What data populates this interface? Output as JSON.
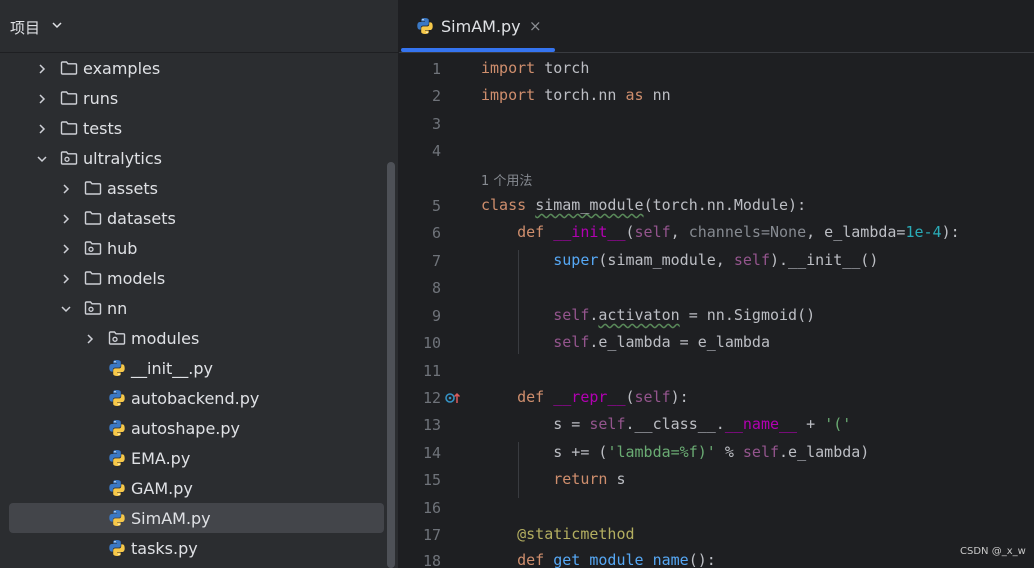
{
  "sidebar": {
    "title": "项目",
    "items": [
      {
        "label": "examples",
        "type": "folder",
        "expanded": false,
        "level": 1
      },
      {
        "label": "runs",
        "type": "folder",
        "expanded": false,
        "level": 1
      },
      {
        "label": "tests",
        "type": "folder",
        "expanded": false,
        "level": 1
      },
      {
        "label": "ultralytics",
        "type": "package",
        "expanded": true,
        "level": 1
      },
      {
        "label": "assets",
        "type": "folder",
        "expanded": false,
        "level": 2
      },
      {
        "label": "datasets",
        "type": "folder",
        "expanded": false,
        "level": 2
      },
      {
        "label": "hub",
        "type": "package",
        "expanded": false,
        "level": 2
      },
      {
        "label": "models",
        "type": "folder",
        "expanded": false,
        "level": 2
      },
      {
        "label": "nn",
        "type": "package",
        "expanded": true,
        "level": 2
      },
      {
        "label": "modules",
        "type": "package",
        "expanded": false,
        "level": 3
      },
      {
        "label": "__init__.py",
        "type": "python",
        "level": 3
      },
      {
        "label": "autobackend.py",
        "type": "python",
        "level": 3
      },
      {
        "label": "autoshape.py",
        "type": "python",
        "level": 3
      },
      {
        "label": "EMA.py",
        "type": "python",
        "level": 3
      },
      {
        "label": "GAM.py",
        "type": "python",
        "level": 3
      },
      {
        "label": "SimAM.py",
        "type": "python",
        "level": 3,
        "selected": true
      },
      {
        "label": "tasks.py",
        "type": "python",
        "level": 3
      }
    ]
  },
  "editor": {
    "tab": {
      "label": "SimAM.py",
      "close": "×"
    },
    "usage_hint": "1 个用法",
    "line_numbers": [
      "1",
      "2",
      "3",
      "4",
      "5",
      "6",
      "7",
      "8",
      "9",
      "10",
      "11",
      "12",
      "13",
      "14",
      "15",
      "16",
      "17",
      "18"
    ],
    "lines": {
      "l1_kw": "import",
      "l1_rest": " torch",
      "l2_kw": "import",
      "l2_mid": " torch.nn ",
      "l2_as": "as",
      "l2_rest": " nn",
      "l5_kw": "class",
      "l5_name": "simam_module",
      "l5_rest": "(torch.nn.Module):",
      "l6_kw": "def",
      "l6_name": "__init__",
      "l6_p1": "(",
      "l6_self": "self",
      "l6_p2": ", ",
      "l6_param": "channels=None",
      "l6_p3": ", e_lambda=",
      "l6_num": "1e-4",
      "l6_p4": "):",
      "l7_super": "super",
      "l7_p1": "(simam_module, ",
      "l7_self": "self",
      "l7_p2": ").__init__()",
      "l9_self": "self",
      "l9_dot": ".",
      "l9_attr": "activaton",
      "l9_rest": " = nn.Sigmoid()",
      "l10_self": "self",
      "l10_rest": ".e_lambda = e_lambda",
      "l12_kw": "def",
      "l12_name": "__repr__",
      "l12_p1": "(",
      "l12_self": "self",
      "l12_p2": "):",
      "l13_a": "s = ",
      "l13_self": "self",
      "l13_b": ".__class__.",
      "l13_dunder": "__name__",
      "l13_c": " + ",
      "l13_str": "'('",
      "l14_a": "s += (",
      "l14_str": "'lambda=%f)'",
      "l14_b": " % ",
      "l14_self": "self",
      "l14_c": ".e_lambda)",
      "l15_kw": "return",
      "l15_rest": " s",
      "l17_deco": "@staticmethod",
      "l18_kw": "def",
      "l18_name": "get_module_name",
      "l18_rest": "():"
    }
  },
  "watermark": "CSDN @_x_w",
  "colors": {
    "accent": "#3574f0",
    "keyword": "#cf8e6d",
    "self": "#94558d",
    "string": "#6aab73",
    "number": "#2aacb8",
    "decorator": "#b3ae60"
  }
}
